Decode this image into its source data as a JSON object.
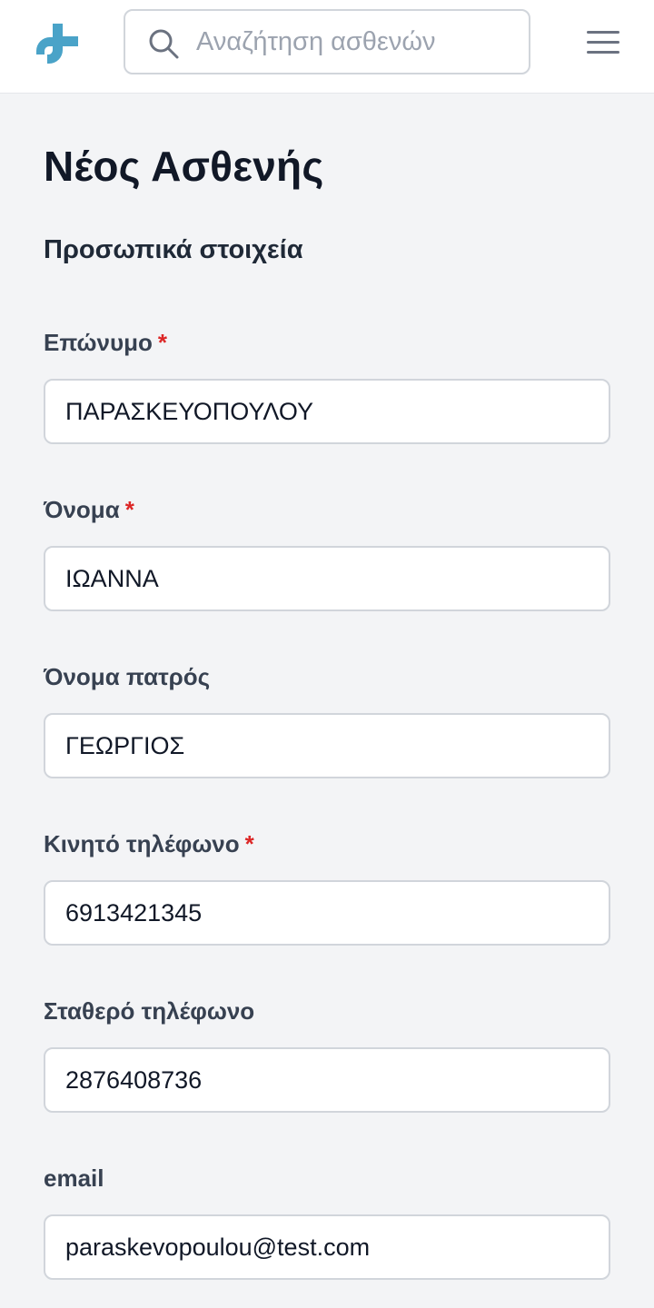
{
  "header": {
    "logo_icon": "medical-cross-logo-icon",
    "search": {
      "icon": "search-icon",
      "placeholder": "Αναζήτηση ασθενών",
      "value": ""
    },
    "menu_icon": "hamburger-menu-icon"
  },
  "page": {
    "title": "Νέος Ασθενής",
    "section_title": "Προσωπικά στοιχεία"
  },
  "form": {
    "required_marker": "*",
    "fields": [
      {
        "label": "Επώνυμο",
        "required": true,
        "value": "ΠΑΡΑΣΚΕΥΟΠΟΥΛΟΥ"
      },
      {
        "label": "Όνομα",
        "required": true,
        "value": "ΙΩΑΝΝΑ"
      },
      {
        "label": "Όνομα πατρός",
        "required": false,
        "value": "ΓΕΩΡΓΙΟΣ"
      },
      {
        "label": "Κινητό τηλέφωνο",
        "required": true,
        "value": "6913421345"
      },
      {
        "label": "Σταθερό τηλέφωνο",
        "required": false,
        "value": "2876408736"
      },
      {
        "label": "email",
        "required": false,
        "value": "paraskevopoulou@test.com"
      }
    ]
  },
  "colors": {
    "accent": "#4aa3c8",
    "required": "#dc2626",
    "background": "#f3f4f6"
  }
}
